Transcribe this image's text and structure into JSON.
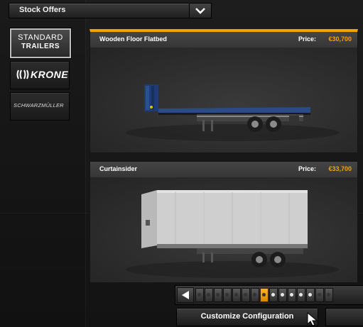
{
  "header": {
    "dropdown_label": "Stock Offers"
  },
  "brands": [
    {
      "line1": "STANDARD",
      "line2": "TRAILERS",
      "active": true
    },
    {
      "name": "KRONE",
      "active": false
    },
    {
      "name": "SCHWARZMÜLLER",
      "active": false
    }
  ],
  "offers": [
    {
      "name": "Wooden Floor Flatbed",
      "price_label": "Price:",
      "price": "€30,700",
      "selected": true
    },
    {
      "name": "Curtainsider",
      "price_label": "Price:",
      "price": "€33,700",
      "selected": false
    }
  ],
  "pager": {
    "current_index": 7,
    "total_slots": 15
  },
  "actions": {
    "customize_label": "Customize Configuration"
  },
  "colors": {
    "accent": "#f5a200",
    "card_bg": "#2e2e2e",
    "header_bg": "#3c3c3c"
  },
  "icons": [
    "chevron-down-icon",
    "krone-logo-icon",
    "arrow-left-icon",
    "mouse-cursor-icon"
  ]
}
